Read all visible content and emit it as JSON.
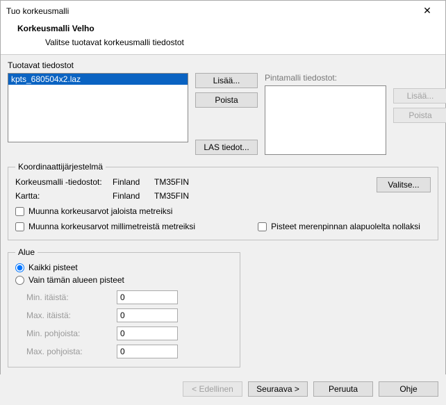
{
  "window": {
    "title": "Tuo korkeusmalli"
  },
  "header": {
    "title": "Korkeusmalli Velho",
    "subtitle": "Valitse tuotavat korkeusmalli tiedostot"
  },
  "files": {
    "group_label": "Tuotavat tiedostot",
    "items": [
      "kpts_680504x2.laz"
    ],
    "btn_add": "Lisää...",
    "btn_remove": "Poista",
    "btn_las": "LAS tiedot..."
  },
  "surface": {
    "label": "Pintamalli tiedostot:",
    "btn_add": "Lisää...",
    "btn_remove": "Poista"
  },
  "crs": {
    "legend": "Koordinaattijärjestelmä",
    "row1_label": "Korkeusmalli -tiedostot:",
    "row1_country": "Finland",
    "row1_crs": "TM35FIN",
    "row2_label": "Kartta:",
    "row2_country": "Finland",
    "row2_crs": "TM35FIN",
    "btn_choose": "Valitse...",
    "chk_feet": "Muunna korkeusarvot jaloista metreiksi",
    "chk_mm": "Muunna korkeusarvot millimetreistä metreiksi",
    "chk_sea": "Pisteet merenpinnan alapuolelta nollaksi"
  },
  "area": {
    "legend": "Alue",
    "opt_all": "Kaikki pisteet",
    "opt_region": "Vain tämän alueen pisteet",
    "min_e_label": "Min. itäistä:",
    "max_e_label": "Max. itäistä:",
    "min_n_label": "Min. pohjoista:",
    "max_n_label": "Max. pohjoista:",
    "min_e": "0",
    "max_e": "0",
    "min_n": "0",
    "max_n": "0"
  },
  "footer": {
    "back": "< Edellinen",
    "next": "Seuraava >",
    "cancel": "Peruuta",
    "help": "Ohje"
  }
}
